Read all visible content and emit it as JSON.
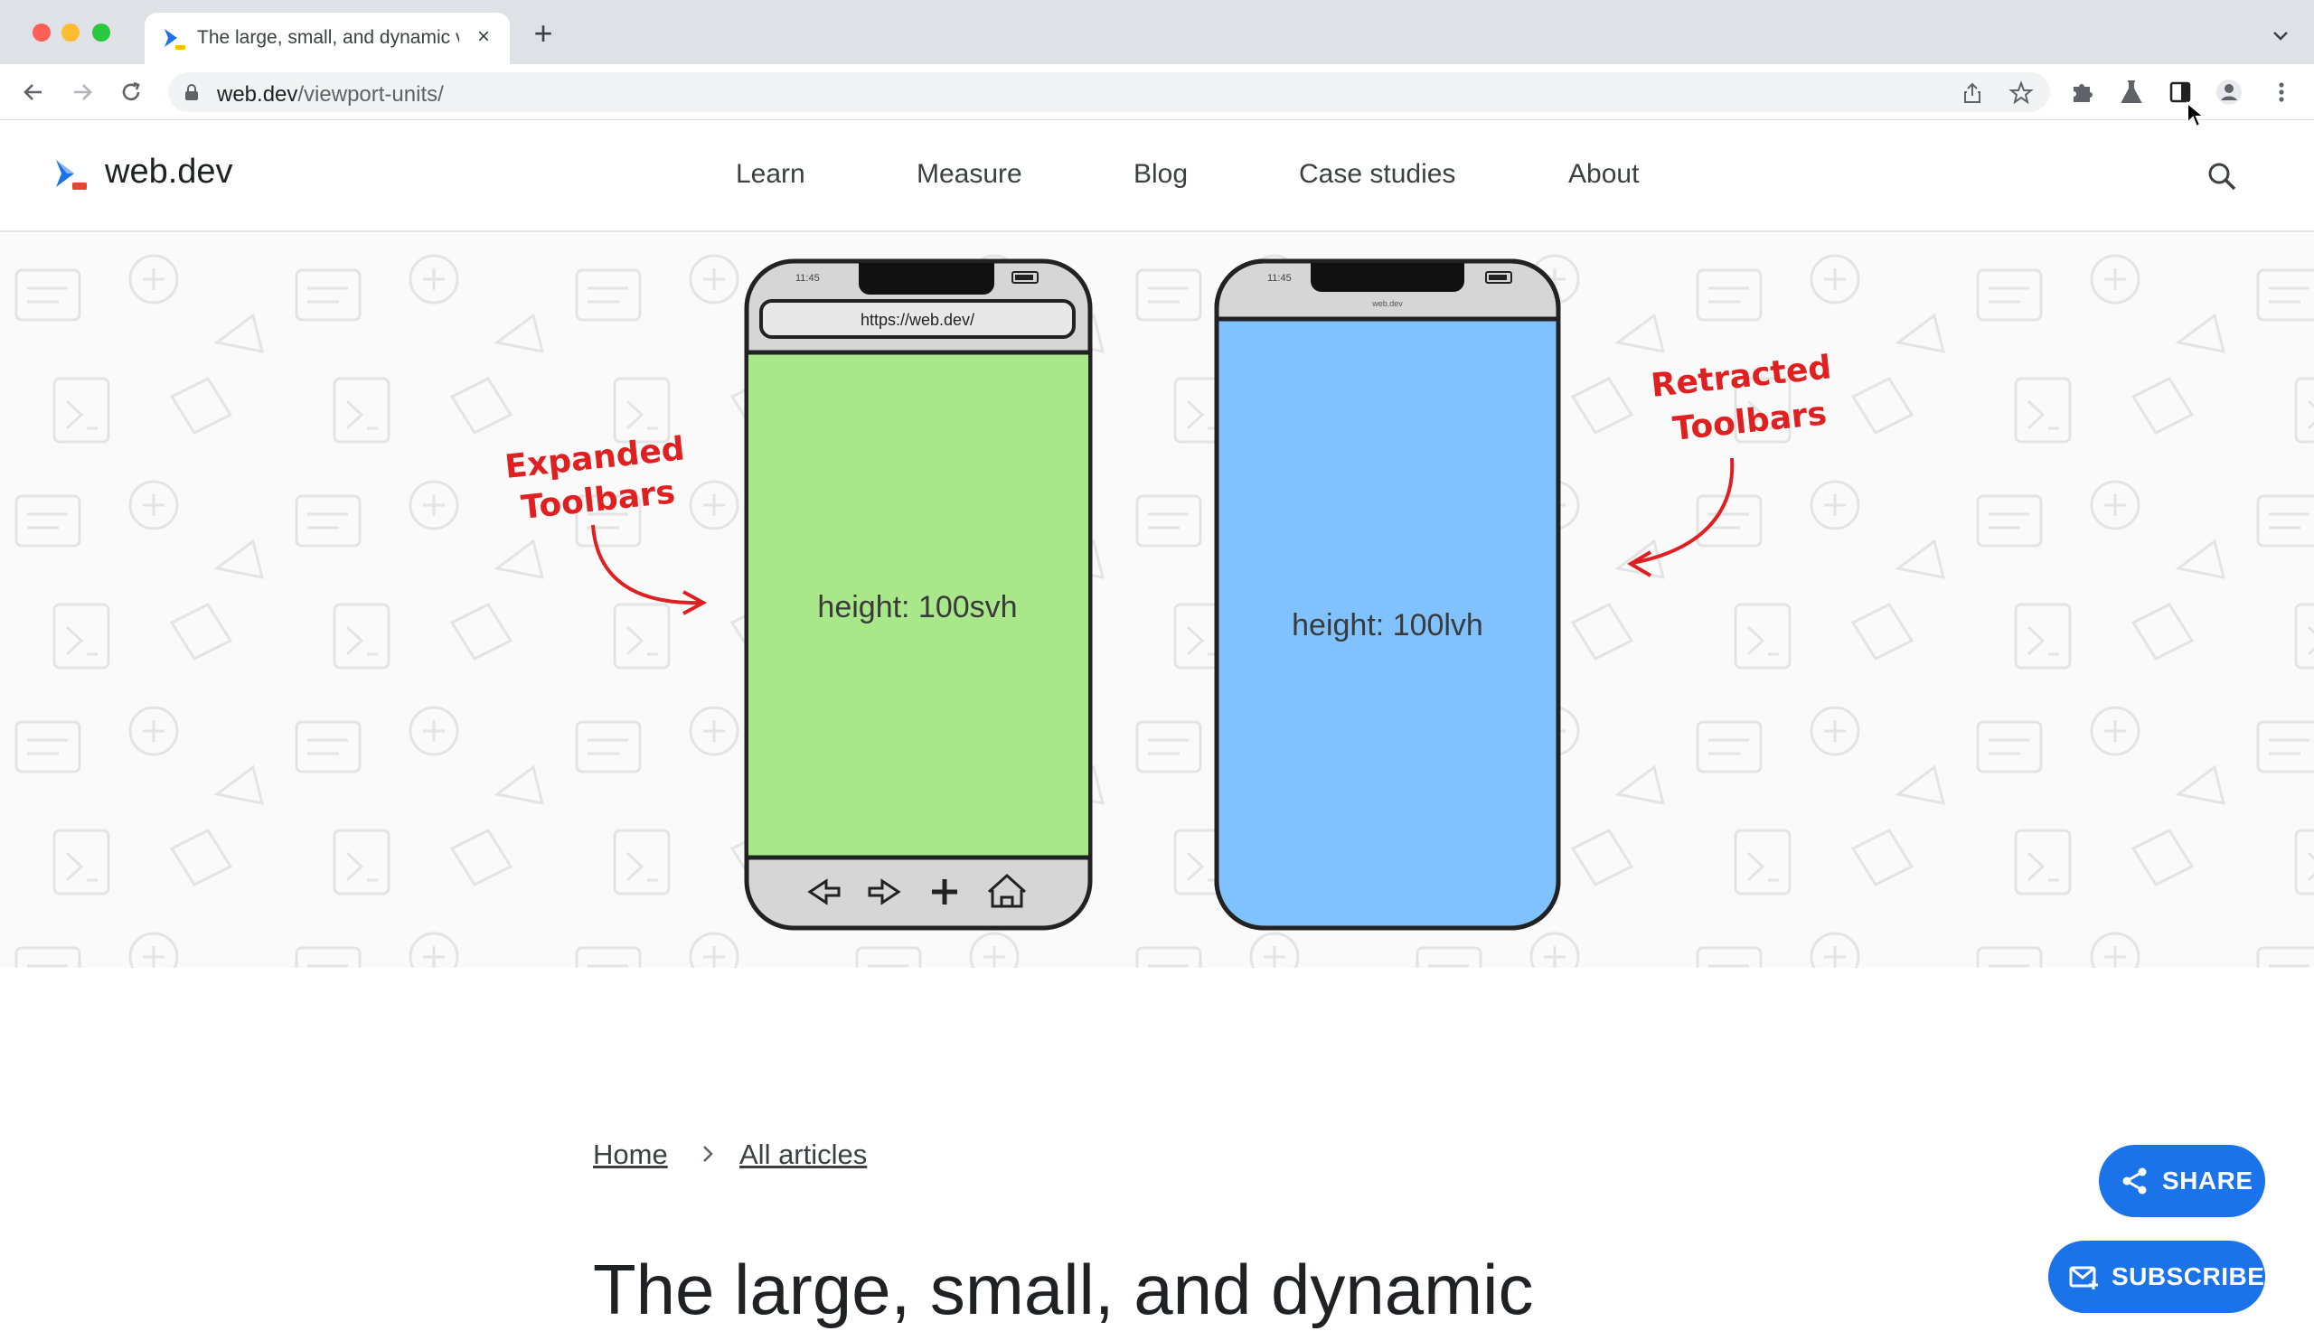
{
  "browser": {
    "tab": {
      "title": "The large, small, and dynamic v",
      "close": "×"
    },
    "new_tab": "+",
    "url": {
      "domain": "web.dev",
      "path": "/viewport-units/"
    }
  },
  "site": {
    "logo": "web.dev",
    "nav": [
      "Learn",
      "Measure",
      "Blog",
      "Case studies",
      "About"
    ]
  },
  "hero": {
    "left_phone": {
      "address": "https://web.dev/",
      "label": "height: 100svh",
      "time": "11:45"
    },
    "right_phone": {
      "address": "web.dev",
      "label": "height: 100lvh",
      "time": "11:45"
    },
    "annotation_left": [
      "Expanded",
      "Toolbars"
    ],
    "annotation_right": [
      "Retracted",
      "Toolbars"
    ]
  },
  "article": {
    "breadcrumb": [
      "Home",
      "All articles"
    ],
    "title": "The large, small, and dynamic"
  },
  "actions": {
    "share": "SHARE",
    "subscribe": "SUBSCRIBE"
  },
  "colors": {
    "accent": "#1a73e8",
    "svh_fill": "#a8e88a",
    "lvh_fill": "#80c2ff",
    "annotation": "#e02020"
  }
}
